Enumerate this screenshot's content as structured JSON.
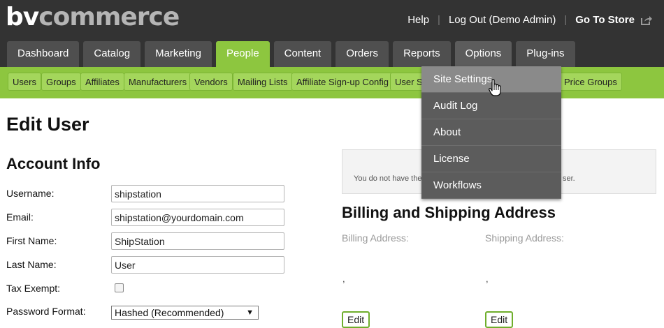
{
  "brand": {
    "logo_bv": "bv",
    "logo_rest": "commerce"
  },
  "top_links": {
    "help": "Help",
    "logout": "Log Out (Demo Admin)",
    "store": "Go To Store",
    "store_icon": "external-link-icon"
  },
  "tabs": [
    {
      "label": "Dashboard"
    },
    {
      "label": "Catalog"
    },
    {
      "label": "Marketing"
    },
    {
      "label": "People"
    },
    {
      "label": "Content"
    },
    {
      "label": "Orders"
    },
    {
      "label": "Reports"
    },
    {
      "label": "Options"
    },
    {
      "label": "Plug-ins"
    }
  ],
  "active_tab": "People",
  "subnav": [
    {
      "label": "Users"
    },
    {
      "label": "Groups"
    },
    {
      "label": "Affiliates"
    },
    {
      "label": "Manufacturers"
    },
    {
      "label": "Vendors"
    },
    {
      "label": "Mailing Lists"
    },
    {
      "label": "Affiliate Sign-up Config"
    },
    {
      "label": "User S"
    },
    {
      "label": "Price Groups"
    }
  ],
  "options_menu": [
    {
      "label": "Site Settings"
    },
    {
      "label": "Audit Log"
    },
    {
      "label": "About"
    },
    {
      "label": "License"
    },
    {
      "label": "Workflows"
    }
  ],
  "page": {
    "title": "Edit User",
    "account_section": "Account Info",
    "fields": {
      "username_label": "Username:",
      "username_value": "shipstation",
      "email_label": "Email:",
      "email_value": "shipstation@yourdomain.com",
      "first_name_label": "First Name:",
      "first_name_value": "ShipStation",
      "last_name_label": "Last Name:",
      "last_name_value": "User",
      "tax_exempt_label": "Tax Exempt:",
      "password_format_label": "Password Format:",
      "password_format_value": "Hashed (Recommended)"
    },
    "notice_left": "You do not have the",
    "notice_right": "ser.",
    "address_section": "Billing and Shipping Address",
    "billing_label": "Billing Address:",
    "shipping_label": "Shipping Address:",
    "billing_value": ",",
    "shipping_value": ",",
    "edit_label": "Edit"
  },
  "colors": {
    "header": "#333333",
    "accent_green": "#8dc63f",
    "dropdown": "#5c5c5c"
  }
}
